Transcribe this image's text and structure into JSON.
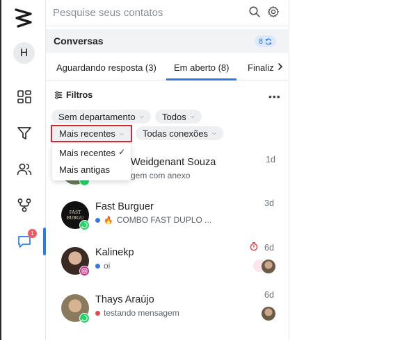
{
  "search": {
    "placeholder": "Pesquise seus contatos"
  },
  "rail": {
    "avatar_initial": "H",
    "chat_badge": "1"
  },
  "conversations": {
    "title": "Conversas",
    "count": "8"
  },
  "tabs": [
    {
      "label": "Aguardando resposta (3)"
    },
    {
      "label": "Em aberto (8)"
    },
    {
      "label": "Finaliz"
    }
  ],
  "filters": {
    "label": "Filtros",
    "department": "Sem departamento",
    "owner": "Todos",
    "sort": "Mais recentes",
    "connections": "Todas conexões"
  },
  "sort_menu": {
    "options": [
      {
        "label": "Mais recentes"
      },
      {
        "label": "Mais antigas"
      }
    ]
  },
  "contacts": [
    {
      "name": "Weidgenant Souza",
      "message": "gem com anexo",
      "time": "1d"
    },
    {
      "name": "Fast Burguer",
      "message": "COMBO FAST DUPLO ...",
      "time": "3d",
      "avatar_text": "FAST BURGU",
      "emoji": "🔥"
    },
    {
      "name": "Kalinekp",
      "message": "oi",
      "time": "6d"
    },
    {
      "name": "Thays Araújo",
      "message": "testando mensagem",
      "time": "6d"
    }
  ],
  "colors": {
    "accent": "#2f7be5",
    "highlight_border": "#d9262c",
    "badge": "#ef5a5a",
    "status_blue": "#2f7be5",
    "status_red": "#e5484d",
    "whatsapp": "#25d366",
    "instagram": "#c13584"
  }
}
